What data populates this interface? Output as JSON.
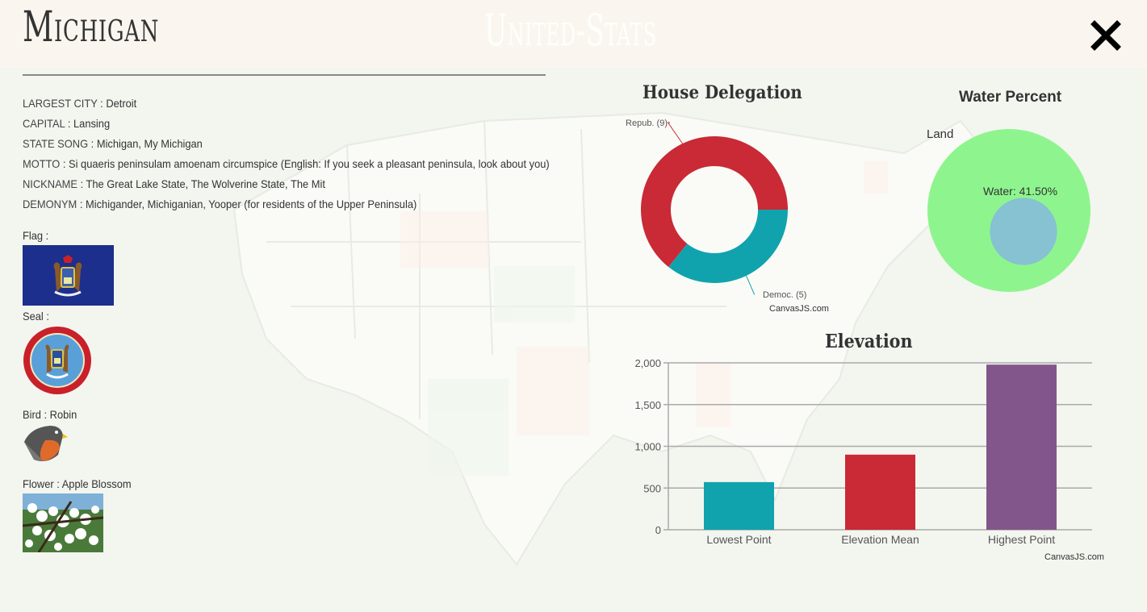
{
  "header": {
    "state_name": "Michigan",
    "site_title": "United-Stats",
    "close_icon": "close-icon"
  },
  "facts": [
    {
      "key": "LARGEST CITY",
      "value": "Detroit"
    },
    {
      "key": "CAPITAL",
      "value": "Lansing"
    },
    {
      "key": "STATE SONG",
      "value": "Michigan, My Michigan"
    },
    {
      "key": "MOTTO",
      "value": "Si quaeris peninsulam amoenam circumspice (English: If you seek a pleasant peninsula, look about you)"
    },
    {
      "key": "NICKNAME",
      "value": "The Great Lake State, The Wolverine State, The Mit"
    },
    {
      "key": "DEMONYM",
      "value": "Michigander, Michiganian, Yooper (for residents of the Upper Peninsula)"
    }
  ],
  "flag": {
    "label": "Flag :"
  },
  "seal": {
    "label": "Seal :"
  },
  "bird": {
    "label": "Bird :",
    "value": "Robin"
  },
  "flower": {
    "label": "Flower :",
    "value": "Apple Blossom"
  },
  "house_delegation": {
    "title": "House Delegation",
    "credit": "CanvasJS.com",
    "chart_data": {
      "type": "pie",
      "title": "House Delegation",
      "slices": [
        {
          "label": "Repub.",
          "value": 9,
          "color": "#c92a35"
        },
        {
          "label": "Democ.",
          "value": 5,
          "color": "#10a3ae"
        }
      ]
    }
  },
  "water_percent": {
    "title": "Water Percent",
    "land_label": "Land",
    "water_label": "Water: 41.50%",
    "chart_data": {
      "type": "area",
      "title": "Water Percent",
      "series": [
        {
          "name": "Land",
          "value": 58.5,
          "color": "#8ef58e"
        },
        {
          "name": "Water",
          "value": 41.5,
          "color": "#86c2d2"
        }
      ]
    }
  },
  "elevation": {
    "title": "Elevation",
    "credit": "CanvasJS.com",
    "chart_data": {
      "type": "bar",
      "title": "Elevation",
      "categories": [
        "Lowest Point",
        "Elevation Mean",
        "Highest Point"
      ],
      "values": [
        571,
        900,
        1979
      ],
      "colors": [
        "#10a3ae",
        "#c92a35",
        "#82568a"
      ],
      "ylim": [
        0,
        2000
      ],
      "yticks": [
        0,
        500,
        1000,
        1500,
        2000
      ],
      "ytick_labels": [
        "0",
        "500",
        "1,000",
        "1,500",
        "2,000"
      ]
    }
  }
}
